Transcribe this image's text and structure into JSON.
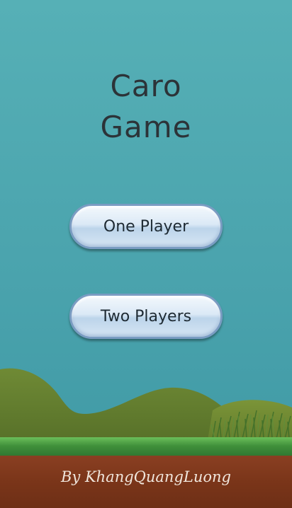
{
  "title": {
    "line1": "Caro",
    "line2": "Game"
  },
  "menu": {
    "one_player": "One Player",
    "two_players": "Two Players"
  },
  "footer": {
    "credit": "By KhangQuangLuong"
  }
}
